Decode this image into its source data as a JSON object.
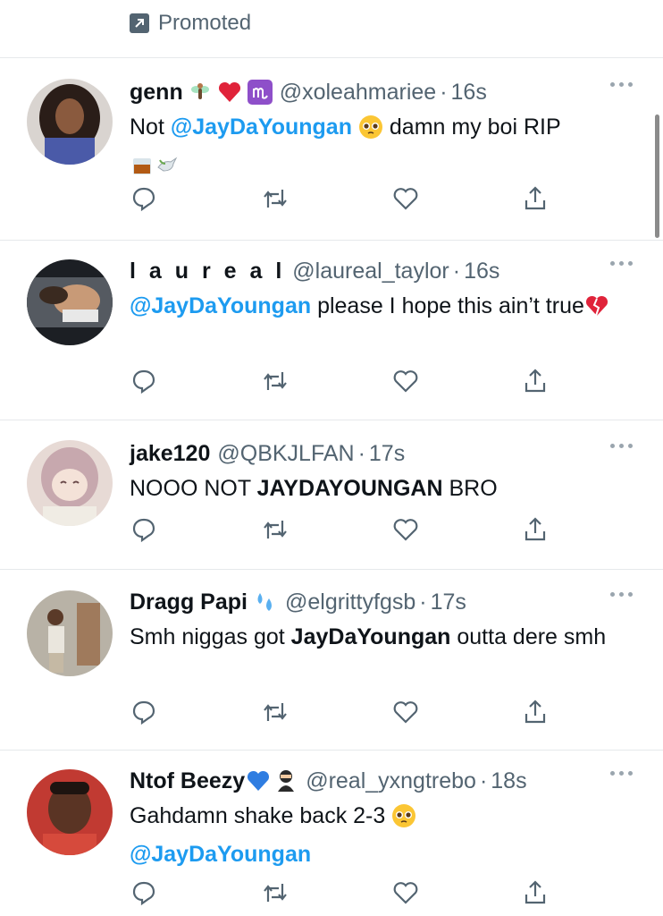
{
  "promoted": {
    "label": "Promoted",
    "icon": "promoted-arrow-icon"
  },
  "colors": {
    "link": "#1d9bf0",
    "muted": "#536471",
    "text": "#0f1419"
  },
  "tweets": [
    {
      "name": "genn",
      "name_emojis": [
        "fairy-emoji",
        "red-heart-emoji",
        "virgo-emoji"
      ],
      "handle": "@xoleahmariee",
      "time": "16s",
      "text_parts": [
        "Not ",
        "@JayDaYoungan",
        " damn my boi RIP"
      ],
      "text_emojis": [
        "pleading-face-emoji",
        "whiskey-glass-emoji",
        "dove-emoji"
      ]
    },
    {
      "name": "l a u r e a l",
      "handle": "@laureal_taylor",
      "time": "16s",
      "text_parts": [
        "@JayDaYoungan",
        " please I hope this ain’t true"
      ],
      "text_emojis": [
        "broken-heart-emoji"
      ]
    },
    {
      "name": "jake120",
      "handle": "@QBKJLFAN",
      "time": "17s",
      "text_parts": [
        "NOOO NOT ",
        "JAYDAYOUNGAN",
        " BRO"
      ]
    },
    {
      "name": "Dragg Papi",
      "name_emojis": [
        "sweat-droplets-emoji"
      ],
      "handle": "@elgrittyfgsb",
      "time": "17s",
      "text_parts": [
        "Smh niggas got ",
        "JayDaYoungan",
        " outta dere smh"
      ]
    },
    {
      "name": "Ntof Beezy",
      "name_emojis": [
        "blue-heart-emoji",
        "ninja-emoji"
      ],
      "handle": "@real_yxngtrebo",
      "time": "18s",
      "text_parts": [
        "Gahdamn shake back 2-3",
        "@JayDaYoungan"
      ],
      "text_emojis": [
        "pleading-face-emoji"
      ]
    }
  ],
  "actions": [
    "reply-icon",
    "retweet-icon",
    "like-icon",
    "share-icon"
  ],
  "separator": "·"
}
